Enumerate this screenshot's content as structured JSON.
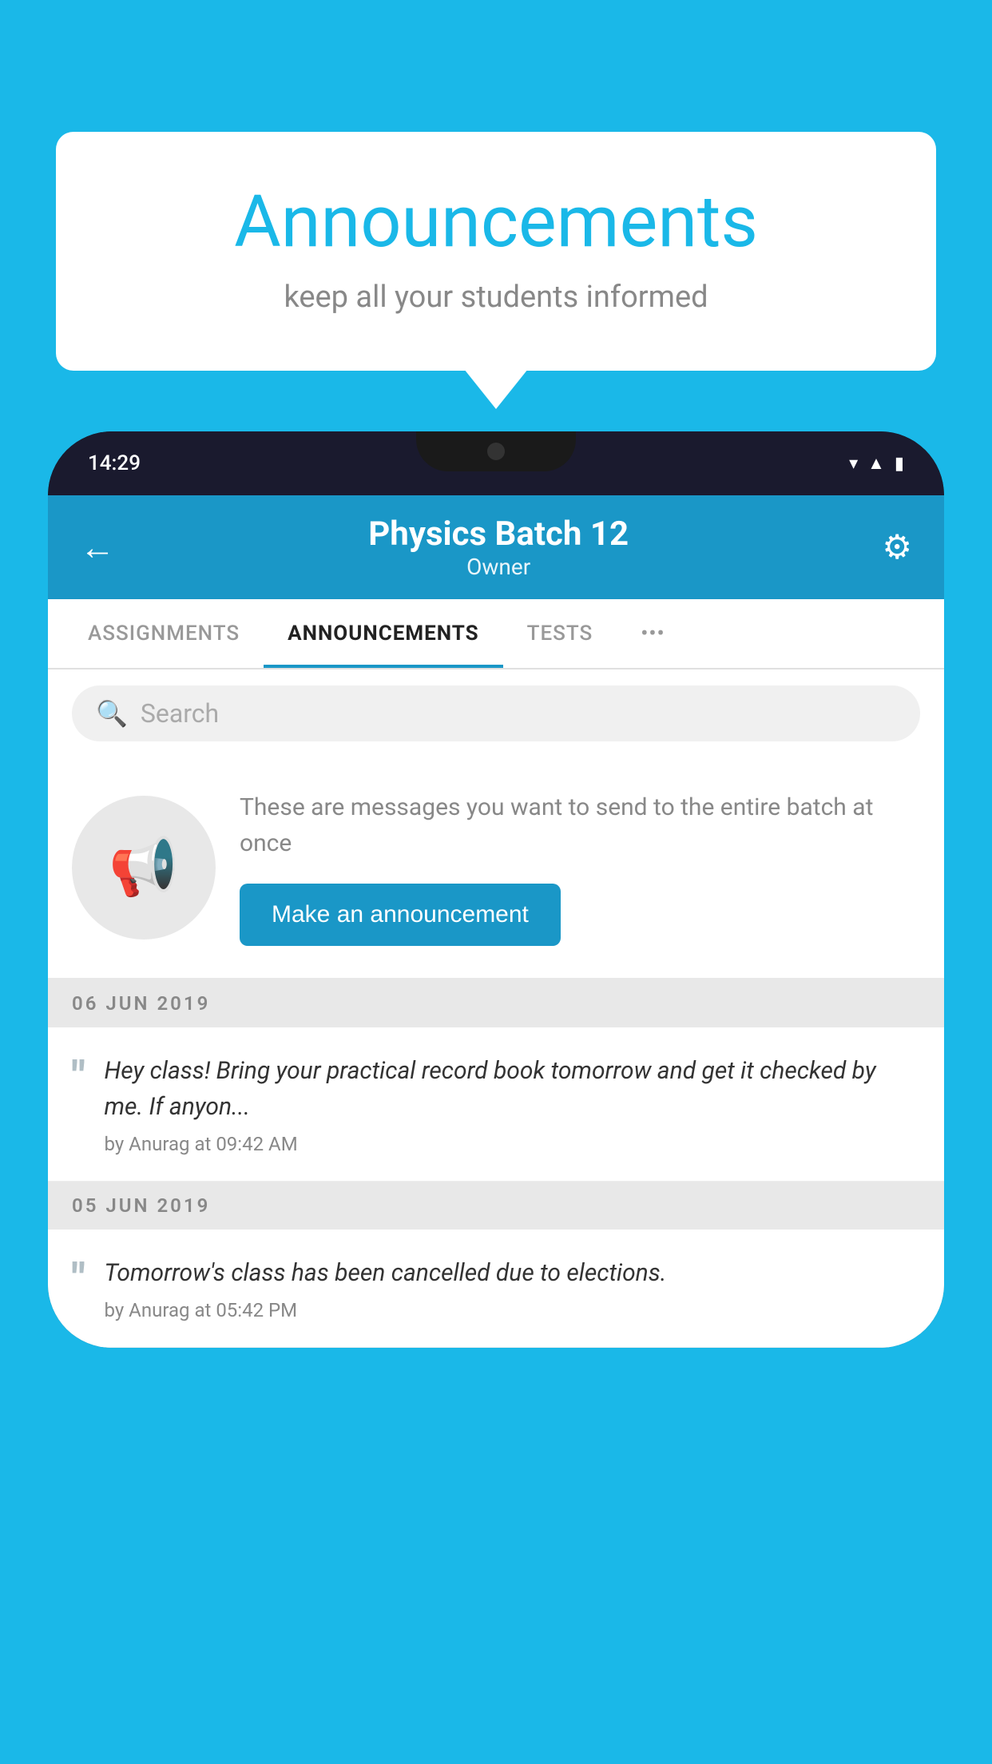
{
  "background_color": "#1ab8e8",
  "speech_bubble": {
    "title": "Announcements",
    "subtitle": "keep all your students informed"
  },
  "status_bar": {
    "time": "14:29",
    "icons": [
      "wifi",
      "signal",
      "battery"
    ]
  },
  "app_bar": {
    "back_label": "←",
    "title": "Physics Batch 12",
    "subtitle": "Owner",
    "settings_label": "⚙"
  },
  "tabs": [
    {
      "label": "ASSIGNMENTS",
      "active": false
    },
    {
      "label": "ANNOUNCEMENTS",
      "active": true
    },
    {
      "label": "TESTS",
      "active": false
    },
    {
      "label": "•••",
      "active": false
    }
  ],
  "search": {
    "placeholder": "Search"
  },
  "promo": {
    "description": "These are messages you want to send to the entire batch at once",
    "button_label": "Make an announcement"
  },
  "announcements": [
    {
      "date": "06  JUN  2019",
      "text": "Hey class! Bring your practical record book tomorrow and get it checked by me. If anyon...",
      "meta": "by Anurag at 09:42 AM"
    },
    {
      "date": "05  JUN  2019",
      "text": "Tomorrow's class has been cancelled due to elections.",
      "meta": "by Anurag at 05:42 PM"
    }
  ]
}
